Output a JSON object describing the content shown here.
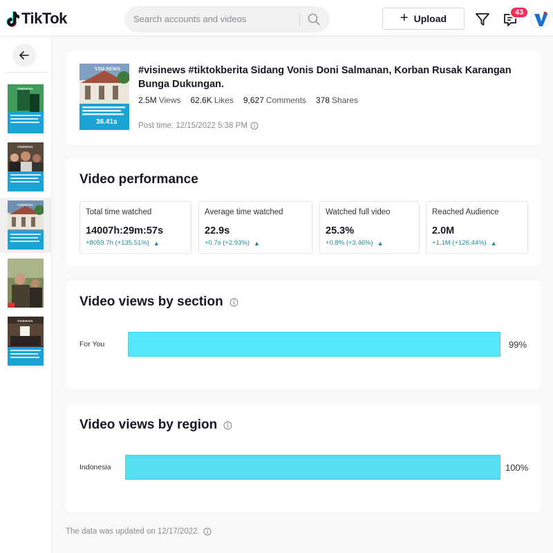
{
  "header": {
    "logo_text": "TikTok",
    "search_placeholder": "Search accounts and videos",
    "upload_label": "Upload",
    "inbox_badge": "43",
    "brand_color": "#fe2c55"
  },
  "sidebar": {
    "videos": [
      {
        "name": "video-1",
        "active": false
      },
      {
        "name": "video-2",
        "active": false
      },
      {
        "name": "video-3",
        "active": true
      },
      {
        "name": "video-4",
        "active": false
      },
      {
        "name": "video-5",
        "active": false
      }
    ]
  },
  "video": {
    "title": "#visinews #tiktokberita Sidang Vonis Doni Salmanan, Korban Rusak Karangan Bunga Dukungan.",
    "duration": "36.41s",
    "thumb_brand": "VISI.NEWS",
    "views": "2.5M",
    "views_label": "Views",
    "likes": "62.6K",
    "likes_label": "Likes",
    "comments": "9,627",
    "comments_label": "Comments",
    "shares": "378",
    "shares_label": "Shares",
    "post_time": "Post time: 12/15/2022 5:38 PM"
  },
  "performance": {
    "title": "Video performance",
    "metrics": [
      {
        "label": "Total time watched",
        "value": "14007h:29m:57s",
        "delta": "+8059.7h (+135.51%)"
      },
      {
        "label": "Average time watched",
        "value": "22.9s",
        "delta": "+0.7s (+2.93%)"
      },
      {
        "label": "Watched full video",
        "value": "25.3%",
        "delta": "+0.8% (+3.46%)"
      },
      {
        "label": "Reached Audience",
        "value": "2.0M",
        "delta": "+1.1M (+126.44%)"
      }
    ]
  },
  "by_section": {
    "title": "Video views by section",
    "rows": [
      {
        "label": "For You",
        "percent": 99,
        "percent_text": "99%"
      }
    ]
  },
  "by_region": {
    "title": "Video views by region",
    "rows": [
      {
        "label": "Indonesia",
        "percent": 100,
        "percent_text": "100%"
      }
    ]
  },
  "footer": {
    "note": "The data was updated on 12/17/2022."
  },
  "colors": {
    "bar": "#56e7ff",
    "delta": "#1a8c99"
  }
}
